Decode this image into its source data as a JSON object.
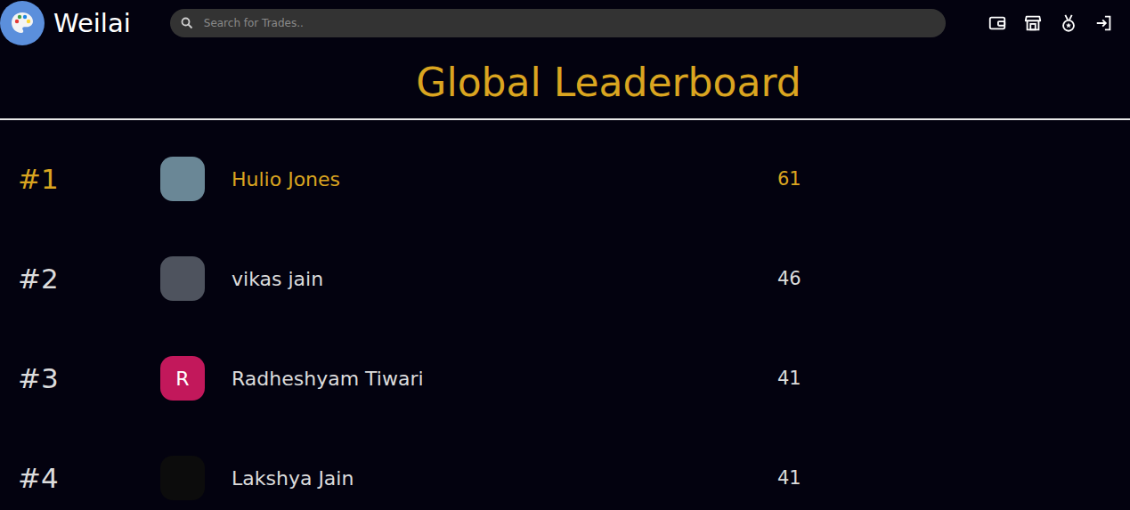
{
  "header": {
    "logo_text": "Weilai",
    "search": {
      "placeholder": "Search for Trades.."
    }
  },
  "leaderboard": {
    "title": "Global Leaderboard",
    "rows": [
      {
        "rank": "#1",
        "name": "Hulio Jones",
        "score": "61",
        "highlighted": true,
        "avatar": {
          "kind": "photo",
          "color": "#6a8796"
        }
      },
      {
        "rank": "#2",
        "name": "vikas jain",
        "score": "46",
        "highlighted": false,
        "avatar": {
          "kind": "photo",
          "color": "#4e535e"
        }
      },
      {
        "rank": "#3",
        "name": "Radheshyam Tiwari",
        "score": "41",
        "highlighted": false,
        "avatar": {
          "kind": "letter",
          "letter": "R",
          "color": "#c2185b"
        }
      },
      {
        "rank": "#4",
        "name": "Lakshya Jain",
        "score": "41",
        "highlighted": false,
        "avatar": {
          "kind": "photo",
          "color": "#0c0c0c"
        }
      }
    ]
  }
}
